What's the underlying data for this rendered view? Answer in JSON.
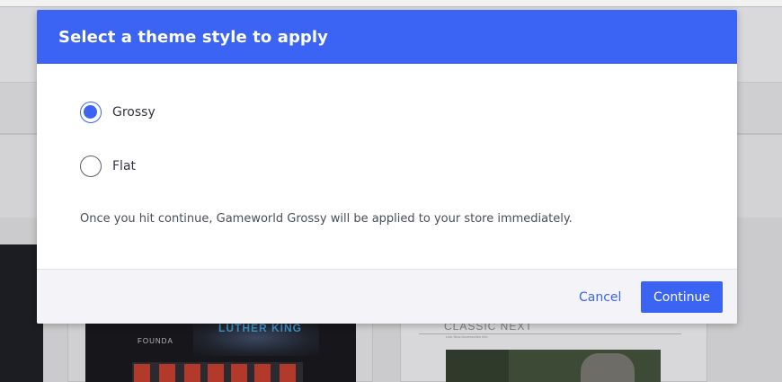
{
  "modal": {
    "title": "Select a theme style to apply",
    "options": [
      {
        "label": "Grossy",
        "checked": true
      },
      {
        "label": "Flat",
        "checked": false
      }
    ],
    "note": "Once you hit continue, Gameworld Grossy will be applied to your store immediately.",
    "cancel_label": "Cancel",
    "continue_label": "Continue"
  },
  "background": {
    "left_preview_title": "LUTHER KING",
    "left_preview_logo": "FOUNDA",
    "right_preview_title": "CLASSIC NEXT",
    "right_preview_menu": "Link  New  Accessories  Info"
  },
  "colors": {
    "accent": "#3c64f4",
    "footer_bg": "#f4f4f8"
  }
}
